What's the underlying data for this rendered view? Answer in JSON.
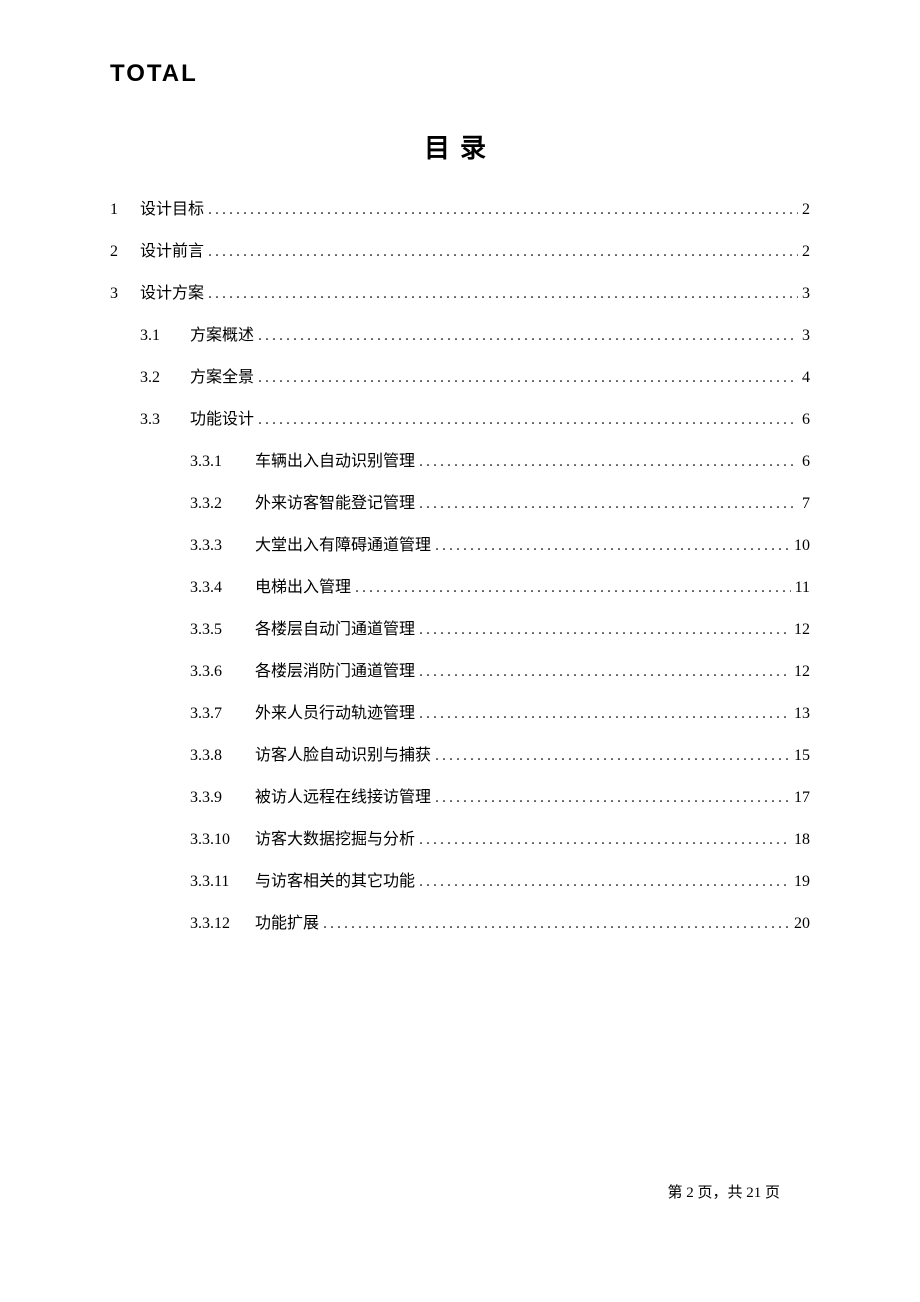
{
  "logo": "TOTAL",
  "title": "目录",
  "toc": [
    {
      "level": 1,
      "num": "1",
      "label": "设计目标",
      "page": "2"
    },
    {
      "level": 1,
      "num": "2",
      "label": "设计前言",
      "page": "2"
    },
    {
      "level": 1,
      "num": "3",
      "label": "设计方案",
      "page": "3"
    },
    {
      "level": 2,
      "num": "3.1",
      "label": "方案概述",
      "page": "3"
    },
    {
      "level": 2,
      "num": "3.2",
      "label": "方案全景",
      "page": "4"
    },
    {
      "level": 2,
      "num": "3.3",
      "label": "功能设计",
      "page": "6"
    },
    {
      "level": 3,
      "num": "3.3.1",
      "label": "车辆出入自动识别管理",
      "page": "6"
    },
    {
      "level": 3,
      "num": "3.3.2",
      "label": "外来访客智能登记管理",
      "page": "7"
    },
    {
      "level": 3,
      "num": "3.3.3",
      "label": "大堂出入有障碍通道管理",
      "page": "10"
    },
    {
      "level": 3,
      "num": "3.3.4",
      "label": "电梯出入管理",
      "page": "11"
    },
    {
      "level": 3,
      "num": "3.3.5",
      "label": "各楼层自动门通道管理",
      "page": "12"
    },
    {
      "level": 3,
      "num": "3.3.6",
      "label": "各楼层消防门通道管理",
      "page": "12"
    },
    {
      "level": 3,
      "num": "3.3.7",
      "label": "外来人员行动轨迹管理",
      "page": "13"
    },
    {
      "level": 3,
      "num": "3.3.8",
      "label": "访客人脸自动识别与捕获",
      "page": "15"
    },
    {
      "level": 3,
      "num": "3.3.9",
      "label": "被访人远程在线接访管理",
      "page": "17"
    },
    {
      "level": 3,
      "num": "3.3.10",
      "label": "访客大数据挖掘与分析",
      "page": "18"
    },
    {
      "level": 3,
      "num": "3.3.11",
      "label": "与访客相关的其它功能",
      "page": "19"
    },
    {
      "level": 3,
      "num": "3.3.12",
      "label": "功能扩展",
      "page": "20"
    }
  ],
  "footer": {
    "prefix": "第",
    "current": "2",
    "mid": "页，共",
    "total": "21",
    "suffix": "页"
  }
}
